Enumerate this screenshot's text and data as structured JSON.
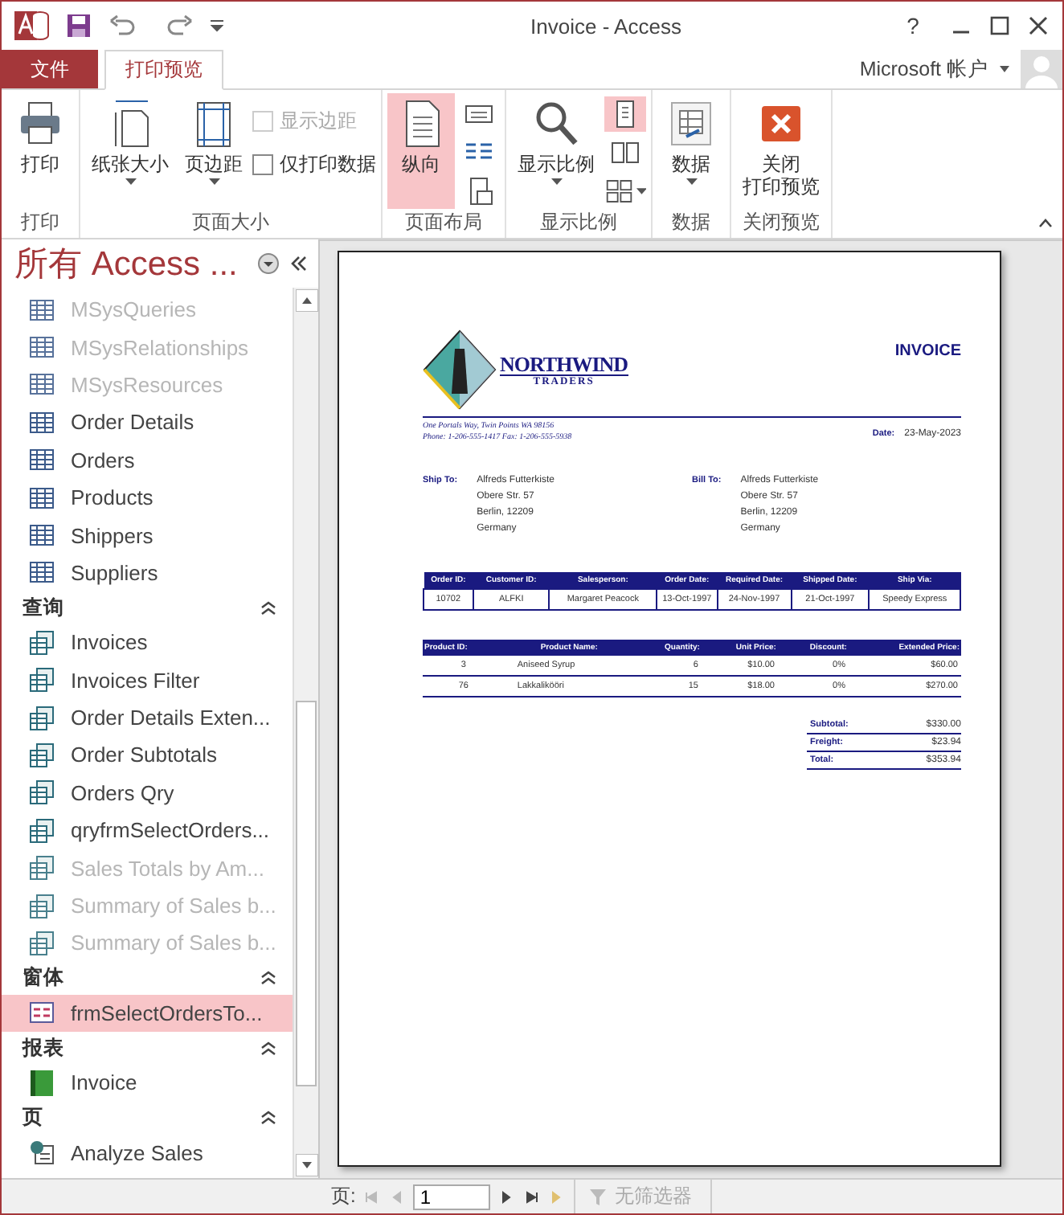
{
  "window": {
    "title": "Invoice - Access",
    "help": "?"
  },
  "tabs": [
    {
      "label": "文件",
      "kind": "file",
      "selected": false
    },
    {
      "label": "打印预览",
      "kind": "tab",
      "selected": true
    }
  ],
  "account": {
    "label": "Microsoft 帐户"
  },
  "ribbon": [
    {
      "label": "打印",
      "controls": [
        {
          "kind": "large",
          "label": "打印",
          "dropdown": false,
          "selected": false
        }
      ]
    },
    {
      "label": "页面大小",
      "controls": [
        {
          "kind": "large",
          "label": "纸张大小",
          "dropdown": true,
          "selected": false
        },
        {
          "kind": "large",
          "label": "页边距",
          "dropdown": true,
          "selected": false
        },
        {
          "kind": "checks",
          "items": [
            {
              "label": "显示边距",
              "checked": false,
              "disabled": true
            },
            {
              "label": "仅打印数据",
              "checked": false,
              "disabled": false
            }
          ]
        }
      ]
    },
    {
      "label": "页面布局",
      "controls": [
        {
          "kind": "large",
          "label": "纵向",
          "dropdown": false,
          "selected": true
        },
        {
          "kind": "icons",
          "items": [
            {
              "selected": false
            },
            {
              "selected": false
            },
            {
              "selected": false
            }
          ]
        }
      ]
    },
    {
      "label": "显示比例",
      "controls": [
        {
          "kind": "large",
          "label": "显示比例",
          "dropdown": true,
          "selected": false
        },
        {
          "kind": "icons",
          "items": [
            {
              "selected": true
            },
            {
              "selected": false
            },
            {
              "selected": false,
              "dropdown": true
            }
          ]
        }
      ]
    },
    {
      "label": "数据",
      "controls": [
        {
          "kind": "large",
          "label": "数据",
          "dropdown": true,
          "selected": false
        }
      ]
    },
    {
      "label": "关闭预览",
      "controls": [
        {
          "kind": "large",
          "label_lines": [
            "关闭",
            "打印预览"
          ],
          "dropdown": false,
          "selected": false
        }
      ]
    }
  ],
  "nav": {
    "title": "所有 Access ...",
    "sections": [
      {
        "items": [
          {
            "label": "MSysQueries",
            "kind": "table",
            "disabled": true,
            "selected": false
          },
          {
            "label": "MSysRelationships",
            "kind": "table",
            "disabled": true,
            "selected": false
          },
          {
            "label": "MSysResources",
            "kind": "table",
            "disabled": true,
            "selected": false
          },
          {
            "label": "Order Details",
            "kind": "table",
            "disabled": false,
            "selected": false
          },
          {
            "label": "Orders",
            "kind": "table",
            "disabled": false,
            "selected": false
          },
          {
            "label": "Products",
            "kind": "table",
            "disabled": false,
            "selected": false
          },
          {
            "label": "Shippers",
            "kind": "table",
            "disabled": false,
            "selected": false
          },
          {
            "label": "Suppliers",
            "kind": "table",
            "disabled": false,
            "selected": false
          }
        ]
      },
      {
        "label": "查询",
        "expanded": true,
        "items": [
          {
            "label": "Invoices",
            "kind": "query",
            "disabled": false,
            "selected": false
          },
          {
            "label": "Invoices Filter",
            "kind": "query",
            "disabled": false,
            "selected": false
          },
          {
            "label": "Order Details Exten...",
            "kind": "query",
            "disabled": false,
            "selected": false
          },
          {
            "label": "Order Subtotals",
            "kind": "query",
            "disabled": false,
            "selected": false
          },
          {
            "label": "Orders Qry",
            "kind": "query",
            "disabled": false,
            "selected": false
          },
          {
            "label": "qryfrmSelectOrders...",
            "kind": "query",
            "disabled": false,
            "selected": false
          },
          {
            "label": "Sales Totals by Am...",
            "kind": "query",
            "disabled": true,
            "selected": false
          },
          {
            "label": "Summary of Sales b...",
            "kind": "query",
            "disabled": true,
            "selected": false
          },
          {
            "label": "Summary of Sales b...",
            "kind": "query",
            "disabled": true,
            "selected": false
          }
        ]
      },
      {
        "label": "窗体",
        "expanded": true,
        "items": [
          {
            "label": "frmSelectOrdersTo...",
            "kind": "form",
            "disabled": false,
            "selected": true
          }
        ]
      },
      {
        "label": "报表",
        "expanded": true,
        "items": [
          {
            "label": "Invoice",
            "kind": "report",
            "disabled": false,
            "selected": false
          }
        ]
      },
      {
        "label": "页",
        "expanded": true,
        "items": [
          {
            "label": "Analyze Sales",
            "kind": "page",
            "disabled": false,
            "selected": false
          }
        ]
      }
    ]
  },
  "report": {
    "company": "NORTHWIND",
    "company_sub": "TRADERS",
    "title": "INVOICE",
    "address": [
      "One Portals Way, Twin Points WA 98156",
      "Phone: 1-206-555-1417   Fax: 1-206-555-5938"
    ],
    "date_label": "Date:",
    "date": "23-May-2023",
    "parties": [
      {
        "label": "Ship To:",
        "lines": [
          "Alfreds Futterkiste",
          "Obere Str. 57",
          "Berlin, 12209",
          "Germany"
        ]
      },
      {
        "label": "Bill To:",
        "lines": [
          "Alfreds Futterkiste",
          "Obere Str. 57",
          "Berlin, 12209",
          "Germany"
        ]
      }
    ],
    "order": {
      "columns": [
        "Order ID:",
        "Customer ID:",
        "Salesperson:",
        "Order Date:",
        "Required Date:",
        "Shipped Date:",
        "Ship Via:"
      ],
      "row": [
        "10702",
        "ALFKI",
        "Margaret Peacock",
        "13-Oct-1997",
        "24-Nov-1997",
        "21-Oct-1997",
        "Speedy Express"
      ]
    },
    "lines": {
      "columns": [
        "Product ID:",
        "Product Name:",
        "Quantity:",
        "Unit Price:",
        "Discount:",
        "Extended Price:"
      ],
      "rows": [
        [
          "3",
          "Aniseed Syrup",
          "6",
          "$10.00",
          "0%",
          "$60.00"
        ],
        [
          "76",
          "Lakkalikööri",
          "15",
          "$18.00",
          "0%",
          "$270.00"
        ]
      ]
    },
    "totals": [
      {
        "label": "Subtotal:",
        "value": "$330.00"
      },
      {
        "label": "Freight:",
        "value": "$23.94"
      },
      {
        "label": "Total:",
        "value": "$353.94"
      }
    ]
  },
  "footer": {
    "page_label": "页:",
    "page": "1",
    "filter": {
      "label": "无筛选器",
      "disabled": true
    }
  }
}
